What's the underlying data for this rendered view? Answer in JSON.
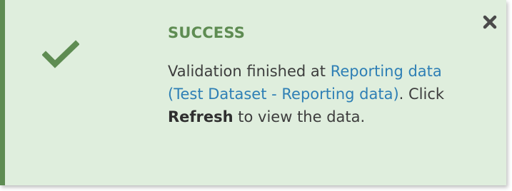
{
  "notification": {
    "type": "success",
    "title": "SUCCESS",
    "message": {
      "prefix": "Validation finished at ",
      "link_text": "Reporting data (Test Dataset - Reporting data)",
      "middle": ". Click ",
      "emphasis": "Refresh",
      "suffix": " to view the data."
    },
    "icons": {
      "status": "checkmark-icon",
      "close": "close-icon"
    },
    "colors": {
      "background": "#dfeedd",
      "accent": "#5e8c52",
      "link": "#2e7fb5",
      "text": "#3d3d3d",
      "close": "#4a4a4a"
    }
  }
}
